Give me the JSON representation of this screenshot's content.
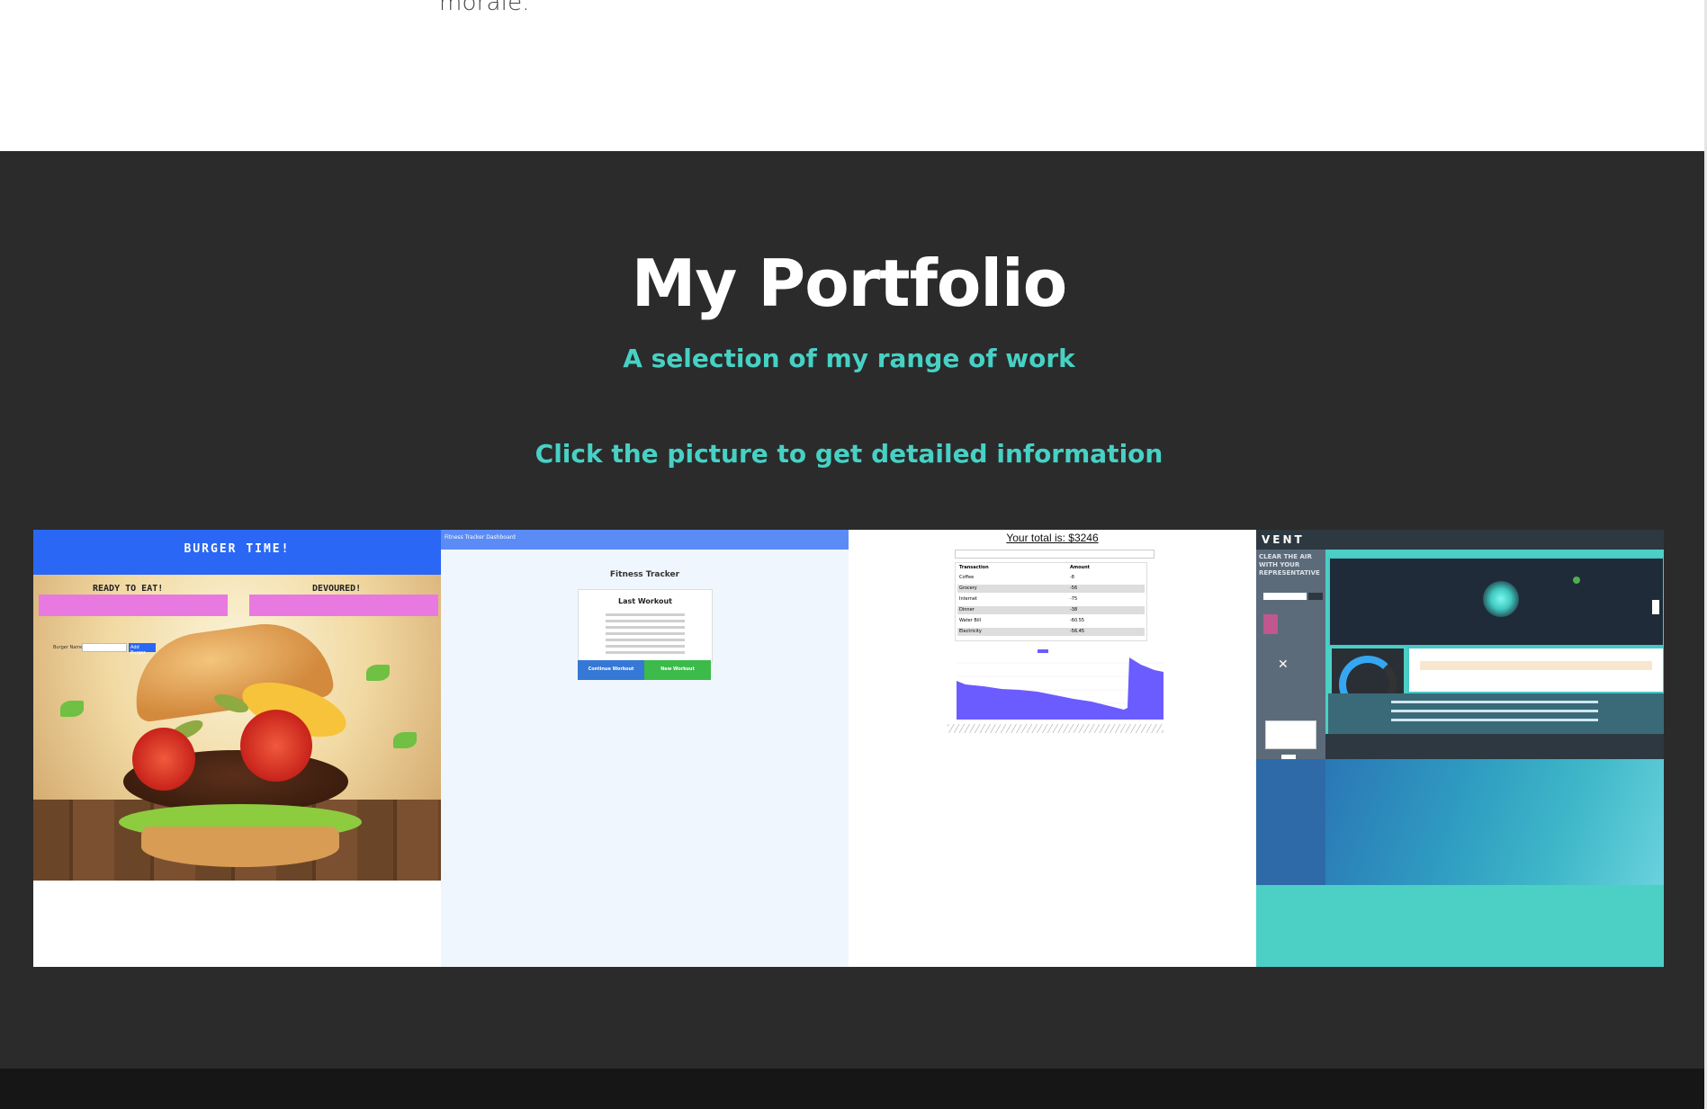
{
  "top": {
    "paragraph_tail": "morale."
  },
  "portfolio": {
    "title": "My Portfolio",
    "subtitle": "A selection of my range of work",
    "instruction": "Click the picture to get detailed information"
  },
  "projects": [
    {
      "banner": "BURGER TIME!",
      "col_left": "READY TO EAT!",
      "col_right": "DEVOURED!",
      "input_label": "Burger Name:",
      "button": "Add Burger"
    },
    {
      "navbar": "Fitness Tracker Dashboard",
      "heading": "Fitness Tracker",
      "panel_title": "Last Workout",
      "button_continue": "Continue Workout",
      "button_new": "New Workout"
    },
    {
      "total": "Your total is: $3246",
      "col_transaction": "Transaction",
      "col_amount": "Amount",
      "rows": [
        {
          "name": "Coffee",
          "amount": "-8"
        },
        {
          "name": "Grocery",
          "amount": "-56"
        },
        {
          "name": "Internet",
          "amount": "-75"
        },
        {
          "name": "Dinner",
          "amount": "-38"
        },
        {
          "name": "Water Bill",
          "amount": "-60.55"
        },
        {
          "name": "Electricity",
          "amount": "-56.45"
        }
      ]
    },
    {
      "brand": "VENT",
      "tagline": "CLEAR THE AIR WITH YOUR REPRESENTATIVE"
    }
  ],
  "colors": {
    "section_bg": "#2b2b2b",
    "accent": "#47d1c5",
    "footer_bg": "#161616"
  }
}
